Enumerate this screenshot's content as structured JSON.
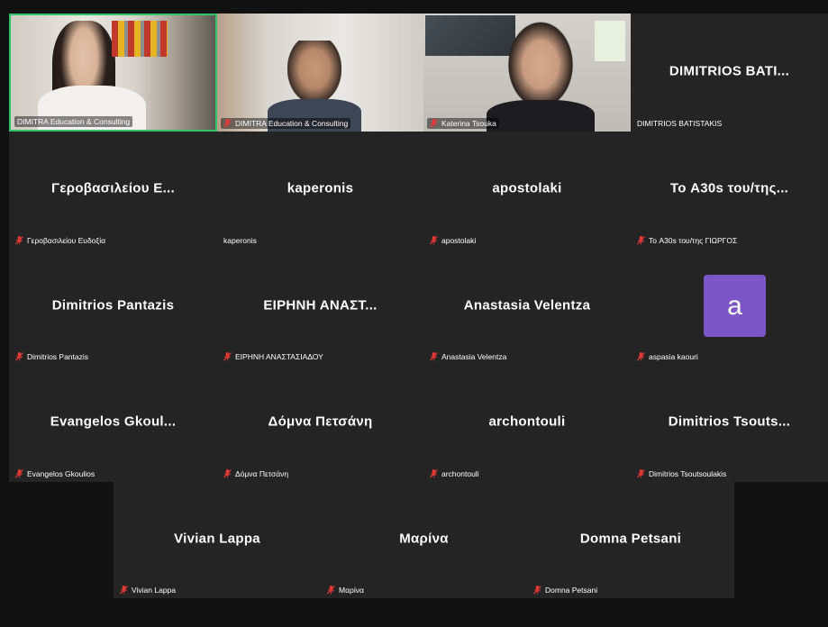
{
  "colors": {
    "tile_bg": "#242424",
    "active_speaker_border": "#31c46b",
    "muted_icon": "#e53935",
    "avatar_bg": "#7c56c7"
  },
  "participants": [
    {
      "center_name": "",
      "label": "DIMITRA Education & Consulting",
      "muted": false,
      "video": true,
      "active_speaker": true
    },
    {
      "center_name": "",
      "label": "DIMITRA Education & Consulting",
      "muted": true,
      "video": true
    },
    {
      "center_name": "",
      "label": "Katerina Tsouka",
      "muted": true,
      "video": true
    },
    {
      "center_name": "DIMITRIOS BATI...",
      "label": "DIMITRIOS BATISTAKIS",
      "muted": false,
      "video": false
    },
    {
      "center_name": "Γεροβασιλείου Ε...",
      "label": "Γεροβασιλείου Ευδοξία",
      "muted": true,
      "video": false
    },
    {
      "center_name": "kaperonis",
      "label": "kaperonis",
      "muted": false,
      "video": false
    },
    {
      "center_name": "apostolaki",
      "label": "apostolaki",
      "muted": true,
      "video": false
    },
    {
      "center_name": "Το A30s του/της...",
      "label": "Το A30s του/της ΓΙΩΡΓΟΣ",
      "muted": true,
      "video": false
    },
    {
      "center_name": "Dimitrios Pantazis",
      "label": "Dimitrios Pantazis",
      "muted": true,
      "video": false
    },
    {
      "center_name": "ΕΙΡΗΝΗ ΑΝΑΣΤ...",
      "label": "ΕΙΡΗΝΗ ΑΝΑΣΤΑΣΙΑΔΟΥ",
      "muted": true,
      "video": false
    },
    {
      "center_name": "Anastasia Velentza",
      "label": "Anastasia Velentza",
      "muted": true,
      "video": false
    },
    {
      "center_name": "",
      "avatar_letter": "a",
      "label": "aspasia kaouri",
      "muted": true,
      "video": false
    },
    {
      "center_name": "Evangelos Gkoul...",
      "label": "Evangelos Gkoulios",
      "muted": true,
      "video": false
    },
    {
      "center_name": "Δόμνα Πετσάνη",
      "label": "Δόμνα Πετσάνη",
      "muted": true,
      "video": false
    },
    {
      "center_name": "archontouli",
      "label": "archontouli",
      "muted": true,
      "video": false
    },
    {
      "center_name": "Dimitrios Tsouts...",
      "label": "Dimitrios Tsoutsoulakis",
      "muted": true,
      "video": false
    },
    {
      "center_name": "Vivian Lappa",
      "label": "Vivian Lappa",
      "muted": true,
      "video": false
    },
    {
      "center_name": "Μαρίνα",
      "label": "Μαρίνα",
      "muted": true,
      "video": false
    },
    {
      "center_name": "Domna Petsani",
      "label": "Domna Petsani",
      "muted": true,
      "video": false
    }
  ]
}
